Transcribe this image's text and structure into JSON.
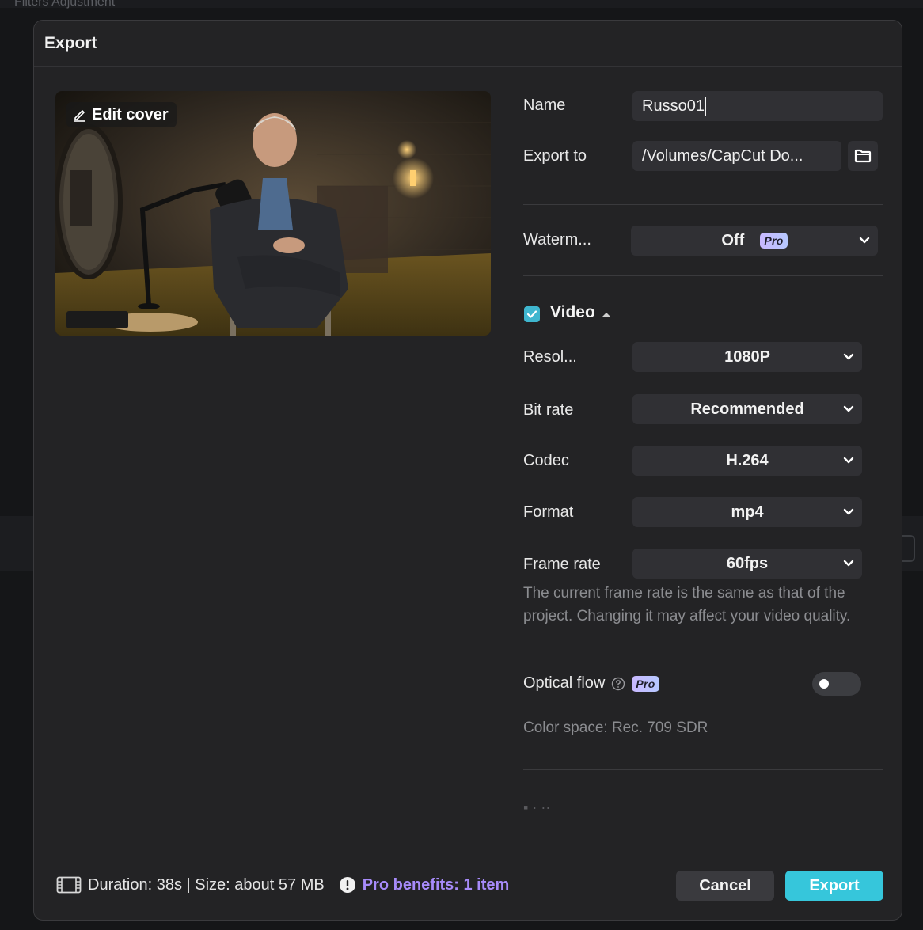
{
  "background": {
    "top_menu_text": "Filters    Adjustment"
  },
  "dialog": {
    "title": "Export",
    "edit_cover_label": "Edit cover",
    "name": {
      "label": "Name",
      "value": "Russo01"
    },
    "export_to": {
      "label": "Export to",
      "value": "/Volumes/CapCut Do..."
    },
    "watermark": {
      "label": "Waterm...",
      "value": "Off",
      "badge": "Pro"
    },
    "video": {
      "section_label": "Video",
      "checked": true,
      "resolution": {
        "label": "Resol...",
        "value": "1080P"
      },
      "bit_rate": {
        "label": "Bit rate",
        "value": "Recommended"
      },
      "codec": {
        "label": "Codec",
        "value": "H.264"
      },
      "format": {
        "label": "Format",
        "value": "mp4"
      },
      "frame_rate": {
        "label": "Frame rate",
        "value": "60fps"
      },
      "frame_rate_note": "The current frame rate is the same as that of the project. Changing it may affect your video quality.",
      "optical_flow": {
        "label": "Optical flow",
        "badge": "Pro",
        "enabled": false
      },
      "color_space": "Color space: Rec. 709 SDR"
    },
    "footer": {
      "info": "Duration: 38s | Size: about 57 MB",
      "pro_benefits": "Pro benefits: 1 item",
      "cancel_label": "Cancel",
      "export_label": "Export"
    }
  },
  "colors": {
    "accent": "#36c6db",
    "pro_text": "#a78bfa",
    "dialog_bg": "#232325",
    "field_bg": "#303034"
  }
}
